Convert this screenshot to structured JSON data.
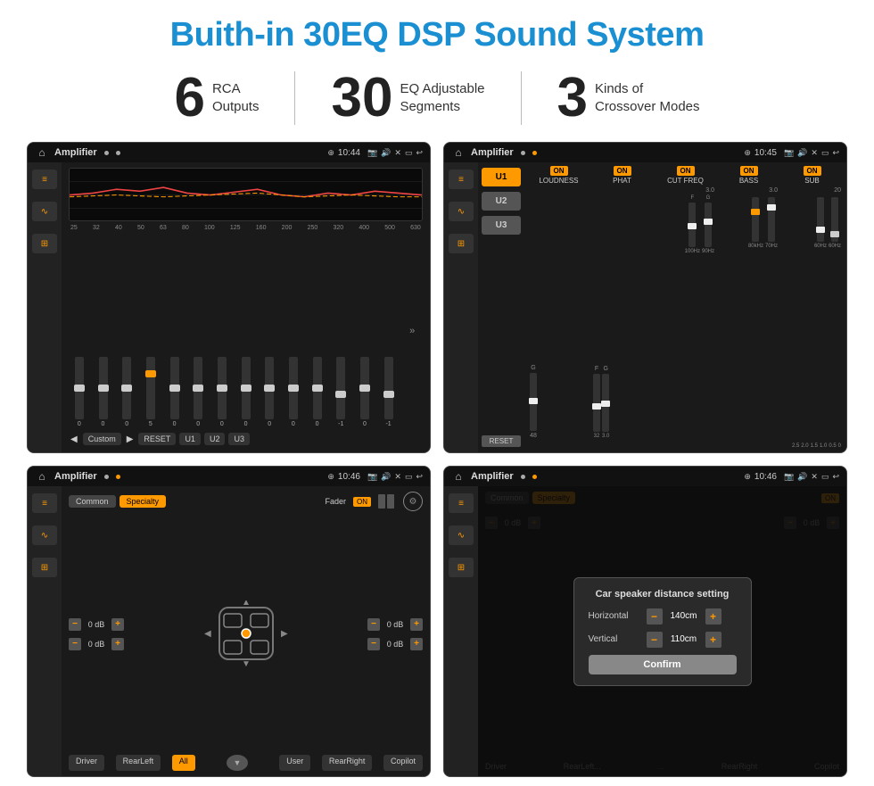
{
  "title": "Buith-in 30EQ DSP Sound System",
  "stats": [
    {
      "number": "6",
      "label": "RCA\nOutputs"
    },
    {
      "number": "30",
      "label": "EQ Adjustable\nSegments"
    },
    {
      "number": "3",
      "label": "Kinds of\nCrossover Modes"
    }
  ],
  "screens": [
    {
      "id": "eq-screen",
      "statusBar": {
        "title": "Amplifier",
        "time": "10:44",
        "dots": [
          "gray",
          "gray"
        ]
      },
      "type": "eq",
      "freqs": [
        "25",
        "32",
        "40",
        "50",
        "63",
        "80",
        "100",
        "125",
        "160",
        "200",
        "250",
        "320",
        "400",
        "500",
        "630"
      ],
      "values": [
        "0",
        "0",
        "0",
        "5",
        "0",
        "0",
        "0",
        "0",
        "0",
        "0",
        "0",
        "-1",
        "0",
        "-1"
      ],
      "bottomBtns": [
        "Custom",
        "RESET",
        "U1",
        "U2",
        "U3"
      ]
    },
    {
      "id": "crossover-screen",
      "statusBar": {
        "title": "Amplifier",
        "time": "10:45",
        "dots": [
          "gray",
          "orange"
        ]
      },
      "type": "crossover",
      "uBtns": [
        "U1",
        "U2",
        "U3"
      ],
      "cols": [
        "LOUDNESS",
        "PHAT",
        "CUT FREQ",
        "BASS",
        "SUB"
      ],
      "resetBtn": "RESET"
    },
    {
      "id": "fader-screen",
      "statusBar": {
        "title": "Amplifier",
        "time": "10:46",
        "dots": [
          "gray",
          "orange"
        ]
      },
      "type": "fader",
      "tabs": [
        "Common",
        "Specialty"
      ],
      "faderLabel": "Fader",
      "onLabel": "ON",
      "dbValues": [
        "0 dB",
        "0 dB",
        "0 dB",
        "0 dB"
      ],
      "buttons": [
        "Driver",
        "RearLeft",
        "All",
        "User",
        "RearRight",
        "Copilot"
      ]
    },
    {
      "id": "dialog-screen",
      "statusBar": {
        "title": "Amplifier",
        "time": "10:46",
        "dots": [
          "gray",
          "orange"
        ]
      },
      "type": "dialog",
      "dialogTitle": "Car speaker distance setting",
      "rows": [
        {
          "label": "Horizontal",
          "value": "140cm"
        },
        {
          "label": "Vertical",
          "value": "110cm"
        }
      ],
      "confirmLabel": "Confirm",
      "tabs": [
        "Common",
        "Specialty"
      ],
      "onLabel": "ON"
    }
  ]
}
